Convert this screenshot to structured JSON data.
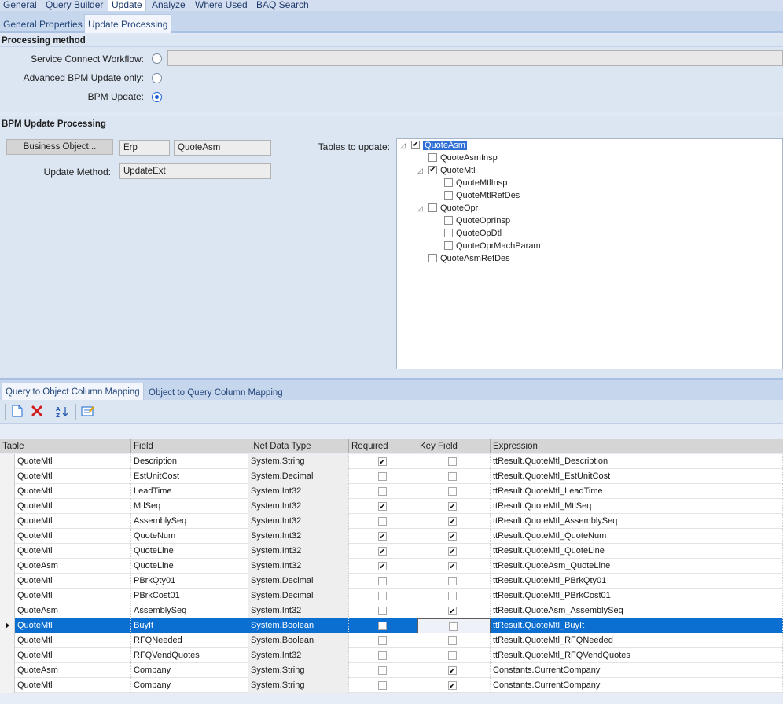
{
  "top_tabs": [
    {
      "label": "General"
    },
    {
      "label": "Query Builder"
    },
    {
      "label": "Update"
    },
    {
      "label": "Analyze"
    },
    {
      "label": "Where Used"
    },
    {
      "label": "BAQ Search"
    }
  ],
  "sub_tabs": [
    {
      "label": "General Properties"
    },
    {
      "label": "Update  Processing"
    }
  ],
  "processing_method": {
    "header": "Processing method",
    "service_connect_label": "Service Connect Workflow:",
    "advanced_bpm_label": "Advanced BPM Update only:",
    "bpm_update_label": "BPM Update:",
    "selected": "BPM Update",
    "service_connect_value": ""
  },
  "bpm_update_processing": {
    "header": "BPM Update Processing",
    "business_object_button": "Business Object...",
    "bo_system": "Erp",
    "bo_name": "QuoteAsm",
    "update_method_label": "Update Method:",
    "update_method_value": "UpdateExt",
    "tables_label": "Tables to update:"
  },
  "tree": [
    {
      "label": "QuoteAsm",
      "checked": true,
      "expander": "◿"
    },
    {
      "label": "QuoteAsmInsp",
      "checked": false,
      "expander": ""
    },
    {
      "label": "QuoteMtl",
      "checked": true,
      "expander": "◿"
    },
    {
      "label": "QuoteMtlInsp",
      "checked": false,
      "expander": ""
    },
    {
      "label": "QuoteMtlRefDes",
      "checked": false,
      "expander": ""
    },
    {
      "label": "QuoteOpr",
      "checked": false,
      "expander": "◿"
    },
    {
      "label": "QuoteOprInsp",
      "checked": false,
      "expander": ""
    },
    {
      "label": "QuoteOpDtl",
      "checked": false,
      "expander": ""
    },
    {
      "label": "QuoteOprMachParam",
      "checked": false,
      "expander": ""
    },
    {
      "label": "QuoteAsmRefDes",
      "checked": false,
      "expander": ""
    }
  ],
  "bottom_tabs": [
    {
      "label": "Query to Object Column Mapping"
    },
    {
      "label": "Object to Query Column Mapping"
    }
  ],
  "toolbar": {
    "new_icon": "new-document-icon",
    "delete_icon": "delete-x-icon",
    "sort_icon": "sort-az-icon",
    "edit_icon": "edit-icon"
  },
  "grid": {
    "headers": [
      "Table",
      "Field",
      ".Net Data Type",
      "Required",
      "Key Field",
      "Expression"
    ],
    "rows": [
      {
        "table": "QuoteMtl",
        "field": "Description",
        "type": "System.String",
        "required": true,
        "key": false,
        "expr": "ttResult.QuoteMtl_Description"
      },
      {
        "table": "QuoteMtl",
        "field": "EstUnitCost",
        "type": "System.Decimal",
        "required": false,
        "key": false,
        "expr": "ttResult.QuoteMtl_EstUnitCost"
      },
      {
        "table": "QuoteMtl",
        "field": "LeadTime",
        "type": "System.Int32",
        "required": false,
        "key": false,
        "expr": "ttResult.QuoteMtl_LeadTime"
      },
      {
        "table": "QuoteMtl",
        "field": "MtlSeq",
        "type": "System.Int32",
        "required": true,
        "key": true,
        "expr": "ttResult.QuoteMtl_MtlSeq"
      },
      {
        "table": "QuoteMtl",
        "field": "AssemblySeq",
        "type": "System.Int32",
        "required": false,
        "key": true,
        "expr": "ttResult.QuoteMtl_AssemblySeq"
      },
      {
        "table": "QuoteMtl",
        "field": "QuoteNum",
        "type": "System.Int32",
        "required": true,
        "key": true,
        "expr": "ttResult.QuoteMtl_QuoteNum"
      },
      {
        "table": "QuoteMtl",
        "field": "QuoteLine",
        "type": "System.Int32",
        "required": true,
        "key": true,
        "expr": "ttResult.QuoteMtl_QuoteLine"
      },
      {
        "table": "QuoteAsm",
        "field": "QuoteLine",
        "type": "System.Int32",
        "required": true,
        "key": true,
        "expr": "ttResult.QuoteAsm_QuoteLine"
      },
      {
        "table": "QuoteMtl",
        "field": "PBrkQty01",
        "type": "System.Decimal",
        "required": false,
        "key": false,
        "expr": "ttResult.QuoteMtl_PBrkQty01"
      },
      {
        "table": "QuoteMtl",
        "field": "PBrkCost01",
        "type": "System.Decimal",
        "required": false,
        "key": false,
        "expr": "ttResult.QuoteMtl_PBrkCost01"
      },
      {
        "table": "QuoteAsm",
        "field": "AssemblySeq",
        "type": "System.Int32",
        "required": false,
        "key": true,
        "expr": "ttResult.QuoteAsm_AssemblySeq"
      },
      {
        "table": "QuoteMtl",
        "field": "BuyIt",
        "type": "System.Boolean",
        "required": false,
        "key": false,
        "expr": "ttResult.QuoteMtl_BuyIt",
        "selected": true
      },
      {
        "table": "QuoteMtl",
        "field": "RFQNeeded",
        "type": "System.Boolean",
        "required": false,
        "key": false,
        "expr": "ttResult.QuoteMtl_RFQNeeded"
      },
      {
        "table": "QuoteMtl",
        "field": "RFQVendQuotes",
        "type": "System.Int32",
        "required": false,
        "key": false,
        "expr": "ttResult.QuoteMtl_RFQVendQuotes"
      },
      {
        "table": "QuoteAsm",
        "field": "Company",
        "type": "System.String",
        "required": false,
        "key": true,
        "expr": "Constants.CurrentCompany"
      },
      {
        "table": "QuoteMtl",
        "field": "Company",
        "type": "System.String",
        "required": false,
        "key": true,
        "expr": "Constants.CurrentCompany"
      }
    ]
  }
}
